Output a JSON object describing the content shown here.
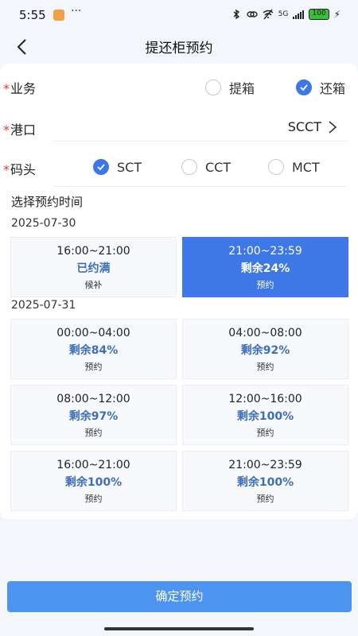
{
  "status_bar": {
    "time": "5:55",
    "dots": "···",
    "network": "5G",
    "battery": "100"
  },
  "nav": {
    "title": "提还柜预约"
  },
  "business": {
    "label": "业务",
    "required_mark": "*",
    "options": [
      {
        "label": "提箱",
        "checked": false
      },
      {
        "label": "还箱",
        "checked": true
      }
    ]
  },
  "port": {
    "label": "港口",
    "required_mark": "*",
    "value": "SCCT"
  },
  "terminal": {
    "label": "码头",
    "required_mark": "*",
    "options": [
      {
        "label": "SCT",
        "checked": true
      },
      {
        "label": "CCT",
        "checked": false
      },
      {
        "label": "MCT",
        "checked": false
      }
    ]
  },
  "schedule": {
    "title": "选择预约时间",
    "days": [
      {
        "date": "2025-07-30",
        "slots": [
          {
            "time": "16:00~21:00",
            "remaining": "已约满",
            "action": "候补",
            "selected": false
          },
          {
            "time": "21:00~23:59",
            "remaining": "剩余24%",
            "action": "预约",
            "selected": true
          }
        ]
      },
      {
        "date": "2025-07-31",
        "slots": [
          {
            "time": "00:00~04:00",
            "remaining": "剩余84%",
            "action": "预约",
            "selected": false
          },
          {
            "time": "04:00~08:00",
            "remaining": "剩余92%",
            "action": "预约",
            "selected": false
          },
          {
            "time": "08:00~12:00",
            "remaining": "剩余97%",
            "action": "预约",
            "selected": false
          },
          {
            "time": "12:00~16:00",
            "remaining": "剩余100%",
            "action": "预约",
            "selected": false
          },
          {
            "time": "16:00~21:00",
            "remaining": "剩余100%",
            "action": "预约",
            "selected": false
          },
          {
            "time": "21:00~23:59",
            "remaining": "剩余100%",
            "action": "预约",
            "selected": false
          }
        ]
      }
    ]
  },
  "confirm_label": "确定预约",
  "colors": {
    "accent": "#3d78e6",
    "button": "#4d94f0",
    "required": "#e8343b",
    "remaining_text": "#3d6fb8"
  }
}
